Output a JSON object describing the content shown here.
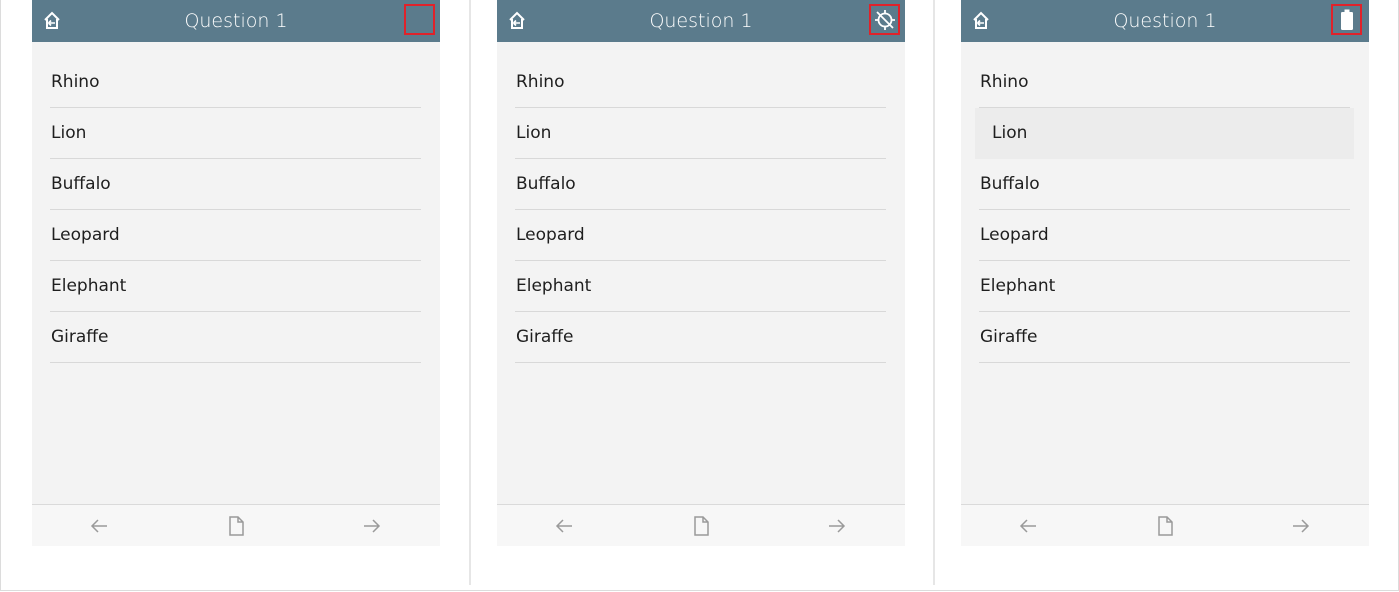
{
  "screens": [
    {
      "title": "Question 1",
      "status_icon": "empty-indicator",
      "items": [
        "Rhino",
        "Lion",
        "Buffalo",
        "Leopard",
        "Elephant",
        "Giraffe"
      ]
    },
    {
      "title": "Question 1",
      "status_icon": "gps-off-icon",
      "items": [
        "Rhino",
        "Lion",
        "Buffalo",
        "Leopard",
        "Elephant",
        "Giraffe"
      ]
    },
    {
      "title": "Question 1",
      "status_icon": "battery-full-icon",
      "items": [
        "Rhino",
        "Lion",
        "Buffalo",
        "Leopard",
        "Elephant",
        "Giraffe"
      ]
    }
  ],
  "footer_icons": [
    "arrow-left-icon",
    "page-icon",
    "arrow-right-icon"
  ],
  "colors": {
    "header": "#5b7b8c",
    "highlight_border": "#e0222a",
    "background": "#f3f3f3"
  }
}
